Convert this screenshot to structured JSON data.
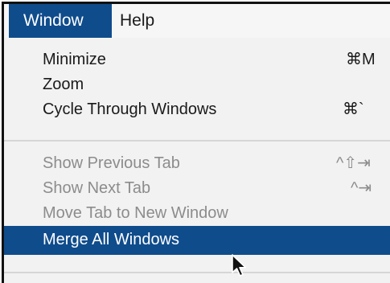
{
  "menubar": {
    "items": [
      {
        "label": "Window",
        "active": true
      },
      {
        "label": "Help",
        "active": false
      }
    ]
  },
  "menu": {
    "groups": [
      {
        "items": [
          {
            "label": "Minimize",
            "shortcut": "⌘M",
            "enabled": true
          },
          {
            "label": "Zoom",
            "shortcut": "",
            "enabled": true
          },
          {
            "label": "Cycle Through Windows",
            "shortcut": "⌘`",
            "enabled": true
          }
        ]
      },
      {
        "items": [
          {
            "label": "Show Previous Tab",
            "shortcut": "^⇧⇥",
            "enabled": false
          },
          {
            "label": "Show Next Tab",
            "shortcut": "^⇥",
            "enabled": false
          },
          {
            "label": "Move Tab to New Window",
            "shortcut": "",
            "enabled": false
          },
          {
            "label": "Merge All Windows",
            "shortcut": "",
            "enabled": true,
            "highlighted": true
          }
        ]
      }
    ]
  },
  "colors": {
    "highlight": "#0f4c8c",
    "disabled_text": "#8c8c8c",
    "menu_background": "#f2f2f2"
  },
  "cursor": {
    "icon": "arrow-pointer-icon"
  }
}
